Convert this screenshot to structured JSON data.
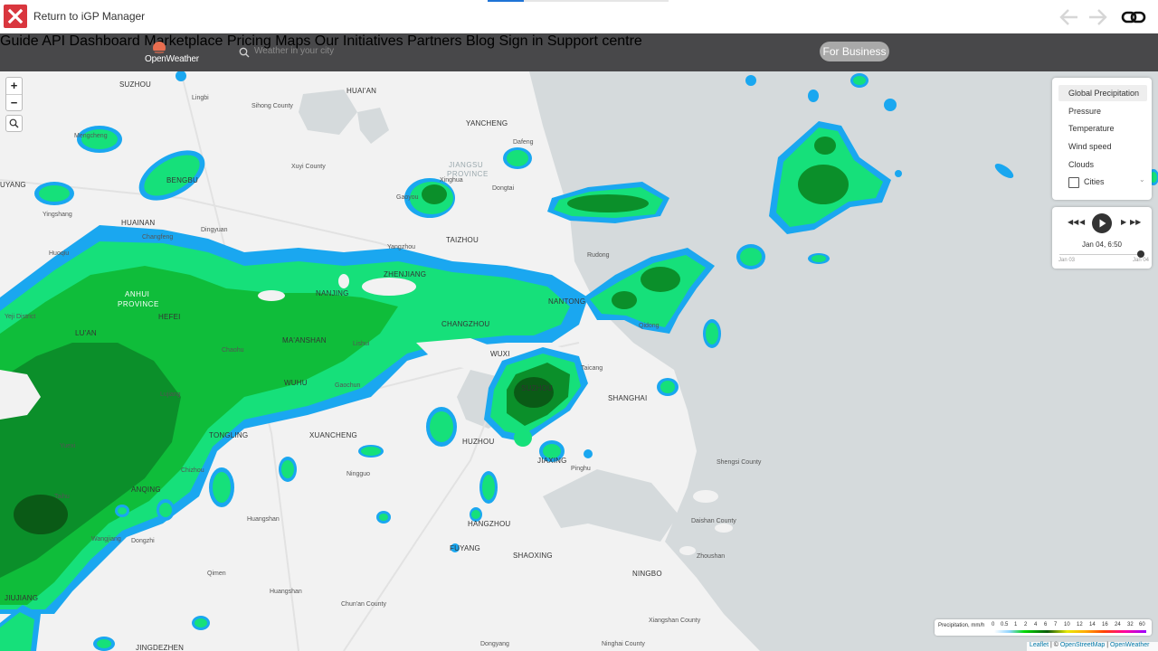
{
  "topbar": {
    "return_label": "Return to iGP Manager",
    "close_icon": "close-x-icon",
    "back_icon": "arrow-left-icon",
    "forward_icon": "arrow-right-icon",
    "link_icon": "link-icon"
  },
  "header": {
    "logo_text": "OpenWeather",
    "search_placeholder": "Weather in your city",
    "menu": [
      "Guide",
      "API",
      "Dashboard",
      "Marketplace",
      "Pricing",
      "Maps",
      "Our Initiatives",
      "Partners",
      "Blog"
    ],
    "business_label": "For Business",
    "signin_label": "Sign in",
    "support_label": "Support centre"
  },
  "zoom": {
    "in": "+",
    "out": "−"
  },
  "layers": {
    "items": [
      "Global Precipitation",
      "Pressure",
      "Temperature",
      "Wind speed",
      "Clouds"
    ],
    "active": "Global Precipitation",
    "cities_label": "Cities"
  },
  "player": {
    "current": "Jan 04, 6:50",
    "start": "Jan 03",
    "end": "Jan 04"
  },
  "legend": {
    "title": "Precipitation, mm/h",
    "ticks": [
      "0",
      "0.5",
      "1",
      "2",
      "4",
      "6",
      "7",
      "10",
      "12",
      "14",
      "16",
      "24",
      "32",
      "60"
    ]
  },
  "attribution": {
    "leaflet": "Leaflet",
    "sep": " | © ",
    "osm": "OpenStreetMap",
    "sep2": " | ",
    "ow": "OpenWeather"
  },
  "map": {
    "labels": {
      "suzhou_n": "SUZHOU",
      "huaian": "HUAI'AN",
      "lingbi": "Lingbi",
      "sihong": "Sihong County",
      "yancheng": "YANCHENG",
      "dafeng": "Dafeng",
      "mengcheng": "Mengcheng",
      "xuyi": "Xuyi County",
      "jiangsu": "JIANGSU",
      "province1": "PROVINCE",
      "bengbu": "BENGBU",
      "yuang": "UYANG",
      "gaoyou": "Gaoyou",
      "xinghua": "Xinghua",
      "dongtai": "Dongtai",
      "huainan": "HUAINAN",
      "yingshang": "Yingshang",
      "dingyuan": "Dingyuan",
      "changfeng": "Changfeng",
      "yangzhou": "Yangzhou",
      "taizhou": "TAIZHOU",
      "rudong": "Rudong",
      "huoqiu": "Huoqiu",
      "zhenjiang": "ZHENJIANG",
      "anhui": "ANHUI",
      "province2": "PROVINCE",
      "nanjing": "NANJING",
      "nantong": "NANTONG",
      "hefei": "HEFEI",
      "yeji": "Yeji District",
      "luan": "LU'AN",
      "changzhou": "CHANGZHOU",
      "qidong": "Qidong",
      "maanshan": "MA'ANSHAN",
      "lishui": "Lishui",
      "wuxi": "WUXI",
      "chaohu": "Chaohu",
      "taicang": "Taicang",
      "wuhu": "WUHU",
      "gaochun": "Gaochun",
      "suzhou": "SUZHOU",
      "lujiang": "Lujiang",
      "shanghai": "SHANGHAI",
      "tongling": "TONGLING",
      "xuancheng": "XUANCHENG",
      "huzhou": "HUZHOU",
      "yuexi": "Yuexi",
      "jiaxing": "JIAXING",
      "shengsi": "Shengsi County",
      "chizhou": "Chizhou",
      "ningguo": "Ningguo",
      "pinghu": "Pinghu",
      "anqing": "ANQING",
      "taihu": "Taihu",
      "huangshan": "Huangshan",
      "hangzhou": "HANGZHOU",
      "daishan": "Daishan County",
      "wangjiang": "Wangjiang",
      "dongzhi": "Dongzhi",
      "zhoushan": "Zhoushan",
      "fuyang": "FUYANG",
      "shaoxing": "SHAOXING",
      "qimen": "Qimen",
      "ningbo": "NINGBO",
      "huangshan2": "Huangshan",
      "jiujiang": "JIUJIANG",
      "chunan": "Chun'an County",
      "xiangshan": "Xiangshan County",
      "jingdezhen": "JINGDEZHEN",
      "dongyang": "Dongyang",
      "ninghai": "Ninghai County"
    }
  }
}
